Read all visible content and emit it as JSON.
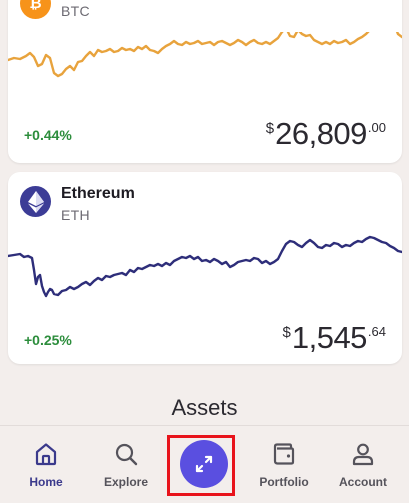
{
  "assets_list": [
    {
      "name": "",
      "symbol": "BTC",
      "icon": "bitcoin-icon",
      "icon_glyph": "₿",
      "change": "+0.44%",
      "price_currency": "$",
      "price_main": "26,809",
      "price_cents": ".00",
      "line_color": "#e8a33d"
    },
    {
      "name": "Ethereum",
      "symbol": "ETH",
      "icon": "ethereum-icon",
      "change": "+0.25%",
      "price_currency": "$",
      "price_main": "1,545",
      "price_cents": ".64",
      "line_color": "#2e2e7a"
    }
  ],
  "section_title": "Assets",
  "nav": {
    "home": "Home",
    "explore": "Explore",
    "trade_icon": "swap-arrows-icon",
    "portfolio": "Portfolio",
    "account": "Account"
  },
  "colors": {
    "accent": "#5a4fe0",
    "positive": "#2c8d3c",
    "highlight": "#e8131b",
    "active_nav": "#3b3a8c"
  }
}
